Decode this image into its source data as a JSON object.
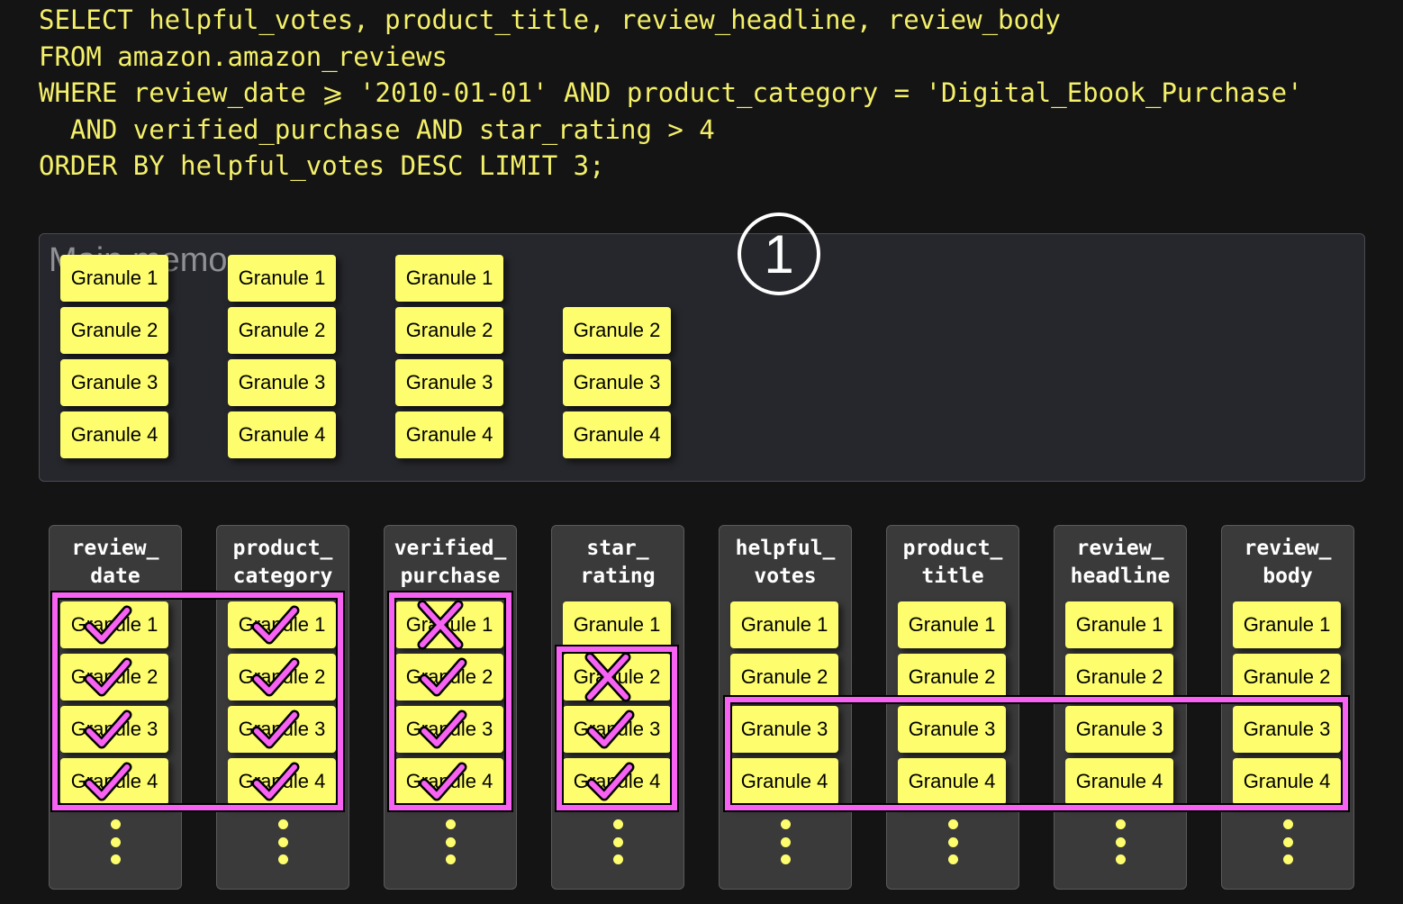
{
  "sql": [
    "SELECT helpful_votes, product_title, review_headline, review_body",
    "FROM amazon.amazon_reviews",
    "WHERE review_date ⩾ '2010-01-01' AND product_category = 'Digital_Ebook_Purchase'",
    "  AND verified_purchase AND star_rating > 4",
    "ORDER BY helpful_votes DESC LIMIT 3;"
  ],
  "memory": {
    "label": "Main memo",
    "step": "1",
    "groups": [
      [
        "Granule 1",
        "Granule 2",
        "Granule 3",
        "Granule 4"
      ],
      [
        "Granule 1",
        "Granule 2",
        "Granule 3",
        "Granule 4"
      ],
      [
        "Granule 1",
        "Granule 2",
        "Granule 3",
        "Granule 4"
      ],
      [
        null,
        "Granule 2",
        "Granule 3",
        "Granule 4"
      ]
    ]
  },
  "columns": [
    {
      "title": "review_\ndate",
      "granules": [
        "Granule 1",
        "Granule 2",
        "Granule 3",
        "Granule 4"
      ],
      "marks": [
        "check",
        "check",
        "check",
        "check"
      ]
    },
    {
      "title": "product_\ncategory",
      "granules": [
        "Granule 1",
        "Granule 2",
        "Granule 3",
        "Granule 4"
      ],
      "marks": [
        "check",
        "check",
        "check",
        "check"
      ]
    },
    {
      "title": "verified_\npurchase",
      "granules": [
        "Granule 1",
        "Granule 2",
        "Granule 3",
        "Granule 4"
      ],
      "marks": [
        "cross",
        "check",
        "check",
        "check"
      ]
    },
    {
      "title": "star_\nrating",
      "granules": [
        "Granule 1",
        "Granule 2",
        "Granule 3",
        "Granule 4"
      ],
      "marks": [
        "none",
        "cross",
        "check",
        "check"
      ]
    },
    {
      "title": "helpful_\nvotes",
      "granules": [
        "Granule 1",
        "Granule 2",
        "Granule 3",
        "Granule 4"
      ],
      "marks": [
        "none",
        "none",
        "none",
        "none"
      ]
    },
    {
      "title": "product_\ntitle",
      "granules": [
        "Granule 1",
        "Granule 2",
        "Granule 3",
        "Granule 4"
      ],
      "marks": [
        "none",
        "none",
        "none",
        "none"
      ]
    },
    {
      "title": "review_\nheadline",
      "granules": [
        "Granule 1",
        "Granule 2",
        "Granule 3",
        "Granule 4"
      ],
      "marks": [
        "none",
        "none",
        "none",
        "none"
      ]
    },
    {
      "title": "review_\nbody",
      "granules": [
        "Granule 1",
        "Granule 2",
        "Granule 3",
        "Granule 4"
      ],
      "marks": [
        "none",
        "none",
        "none",
        "none"
      ]
    }
  ],
  "colors": {
    "highlight": "#f862f3",
    "granule": "#fdfd6e",
    "sql": "#f4f06a"
  }
}
